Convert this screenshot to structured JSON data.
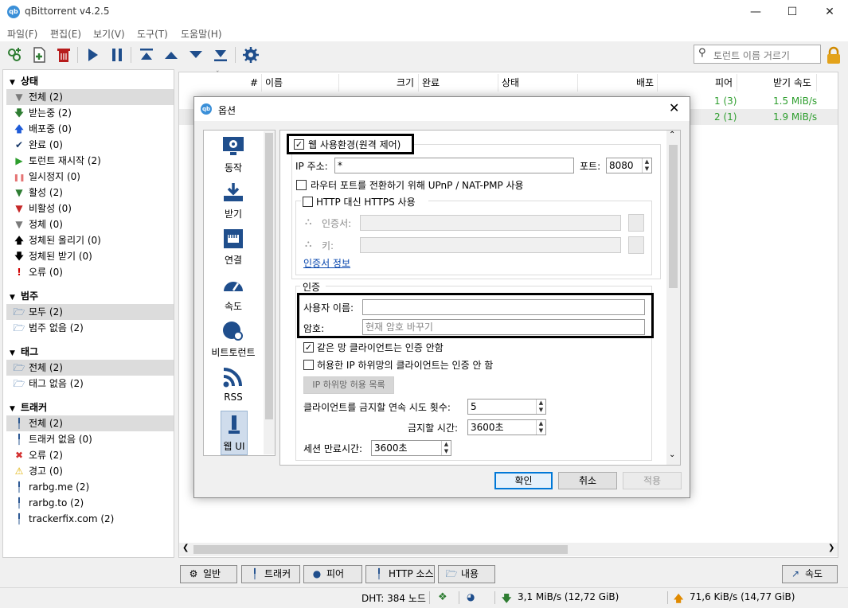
{
  "window": {
    "title": "qBittorrent v4.2.5"
  },
  "menu": [
    "파일(F)",
    "편집(E)",
    "보기(V)",
    "도구(T)",
    "도움말(H)"
  ],
  "toolbar": {
    "search_placeholder": "토런트 이름 거르기"
  },
  "sidebar": {
    "status": {
      "header": "상태",
      "items": [
        {
          "label": "전체 (2)",
          "icon": "filter-icon",
          "color": "#7a7a7a"
        },
        {
          "label": "받는중 (2)",
          "icon": "arrow-down-icon",
          "color": "#2e7d32"
        },
        {
          "label": "배포중 (0)",
          "icon": "arrow-up-icon",
          "color": "#1e5bd8"
        },
        {
          "label": "완료 (0)",
          "icon": "check-icon",
          "color": "#1a3a6a"
        },
        {
          "label": "토런트 재시작 (2)",
          "icon": "play-icon",
          "color": "#2e9e2e"
        },
        {
          "label": "일시정지 (0)",
          "icon": "pause-icon",
          "color": "#e57373"
        },
        {
          "label": "활성 (2)",
          "icon": "filter-green-icon",
          "color": "#2e7d32"
        },
        {
          "label": "비활성 (0)",
          "icon": "filter-red-icon",
          "color": "#c62828"
        },
        {
          "label": "정체 (0)",
          "icon": "filter-gray-icon",
          "color": "#7a7a7a"
        },
        {
          "label": "정체된 올리기 (0)",
          "icon": "arrow-up-black-icon",
          "color": "#000"
        },
        {
          "label": "정체된 받기 (0)",
          "icon": "arrow-down-black-icon",
          "color": "#000"
        },
        {
          "label": "오류 (0)",
          "icon": "exclamation-icon",
          "color": "#d00000"
        }
      ]
    },
    "categories": {
      "header": "범주",
      "items": [
        {
          "label": "모두 (2)"
        },
        {
          "label": "범주 없음 (2)"
        }
      ]
    },
    "tags": {
      "header": "태그",
      "items": [
        {
          "label": "전체 (2)"
        },
        {
          "label": "태그 없음 (2)"
        }
      ]
    },
    "trackers": {
      "header": "트래커",
      "items": [
        {
          "label": "전체 (2)",
          "icon": "tracker-icon"
        },
        {
          "label": "트래커 없음 (0)",
          "icon": "tracker-icon"
        },
        {
          "label": "오류 (2)",
          "icon": "error-circle-icon"
        },
        {
          "label": "경고 (0)",
          "icon": "warning-icon"
        },
        {
          "label": "rarbg.me (2)",
          "icon": "tracker-icon"
        },
        {
          "label": "rarbg.to (2)",
          "icon": "tracker-icon"
        },
        {
          "label": "trackerfix.com (2)",
          "icon": "tracker-icon"
        }
      ]
    }
  },
  "torrent_list": {
    "columns": [
      "#",
      "이름",
      "크기",
      "완료",
      "상태",
      "배포",
      "피어",
      "받기 속도"
    ],
    "rows": [
      {
        "peers": "1 (3)",
        "down_speed": "1.5 MiB/s"
      },
      {
        "peers": "2 (1)",
        "down_speed": "1.9 MiB/s"
      }
    ]
  },
  "bottom_tabs": [
    "일반",
    "트래커",
    "피어",
    "HTTP 소스",
    "내용"
  ],
  "speed_tab": "속도",
  "statusbar": {
    "dht": "DHT: 384 노드",
    "download": "3,1 MiB/s (12,72 GiB)",
    "upload": "71,6 KiB/s (14,77 GiB)"
  },
  "dialog": {
    "title": "옵션",
    "categories": [
      "동작",
      "받기",
      "연결",
      "속도",
      "비트토런트",
      "RSS",
      "웹 UI"
    ],
    "webui": {
      "enable_label": "웹 사용환경(원격 제어)",
      "enable_checked": true,
      "ip_label": "IP 주소:",
      "ip_value": "*",
      "port_label": "포트:",
      "port_value": "8080",
      "upnp_label": "라우터 포트를 전환하기 위해 UPnP / NAT-PMP 사용",
      "upnp_checked": false,
      "https_label": "HTTP 대신 HTTPS 사용",
      "https_checked": false,
      "cert_label": "인증서:",
      "key_label": "키:",
      "cert_info_link": "인증서 정보",
      "auth_group": "인증",
      "username_label": "사용자 이름:",
      "username_value": "",
      "password_label": "암호:",
      "password_placeholder": "현재 암호 바꾸기",
      "bypass_local_label": "같은 망 클라이언트는 인증 안함",
      "bypass_local_checked": true,
      "bypass_whitelist_label": "허용한 IP 하위망의 클라이언트는 인증 안 함",
      "bypass_whitelist_checked": false,
      "whitelist_button": "IP 하위망 허용 목록",
      "ban_count_label": "클라이언트를 금지할 연속 시도 횟수:",
      "ban_count_value": "5",
      "ban_time_label": "금지할 시간:",
      "ban_time_value": "3600초",
      "session_timeout_label": "세션 만료시간:",
      "session_timeout_value": "3600초"
    },
    "buttons": {
      "ok": "확인",
      "cancel": "취소",
      "apply": "적용"
    }
  }
}
